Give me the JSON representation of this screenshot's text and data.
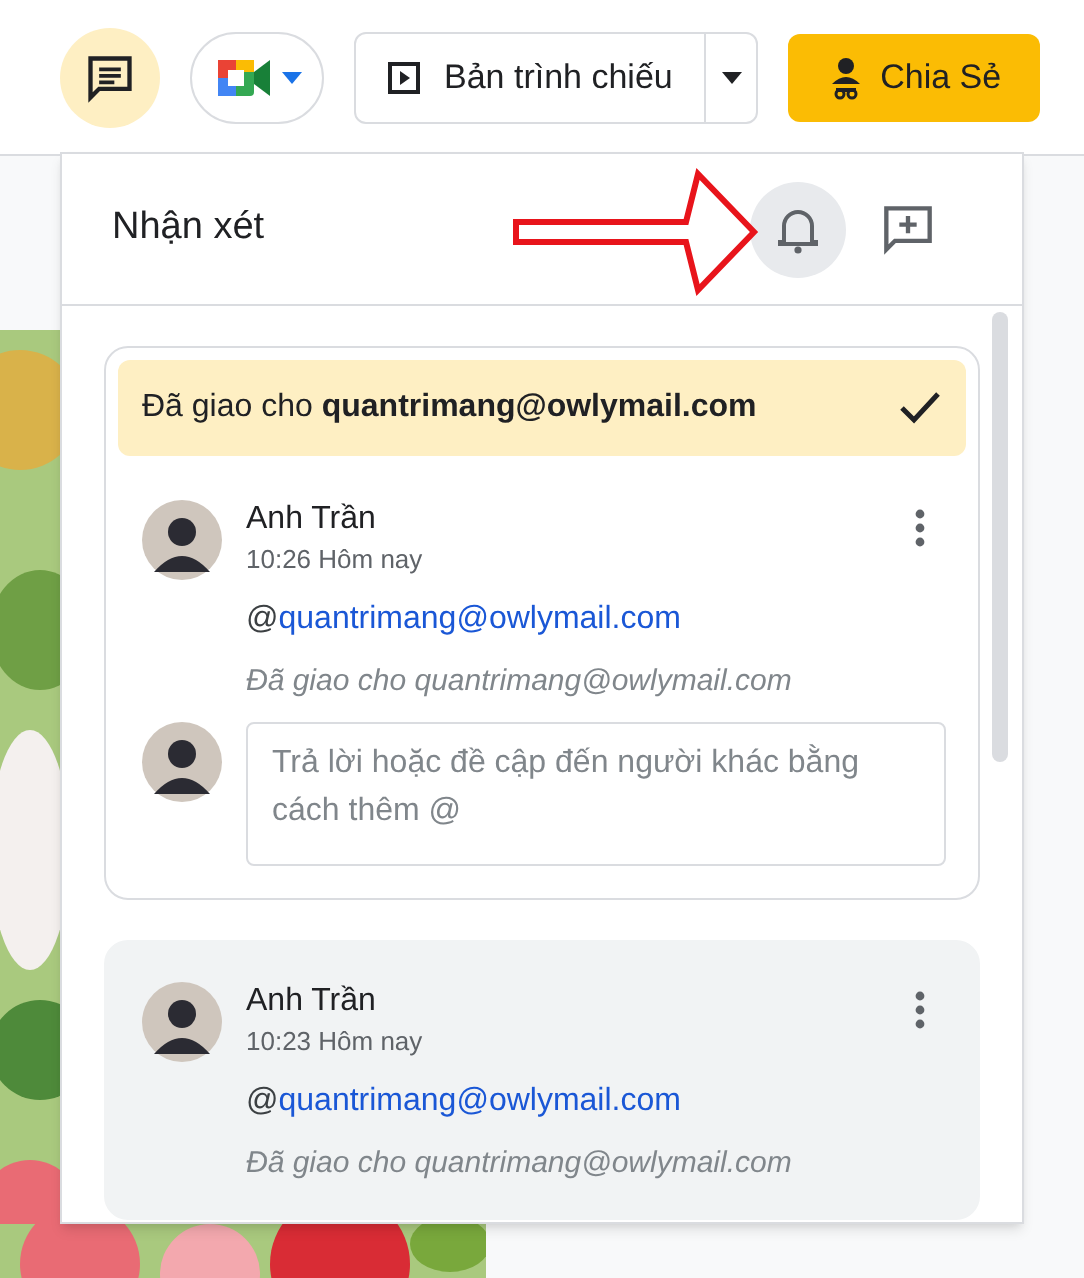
{
  "toolbar": {
    "comments_button": {
      "selected": true
    },
    "slideshow_button": {
      "label": "Bản trình chiếu"
    },
    "share_button": {
      "label": "Chia Sẻ"
    }
  },
  "comments_panel": {
    "title": "Nhận xét",
    "notifications_button": {
      "selected": true
    }
  },
  "threads": [
    {
      "selected": false,
      "banner": "Đã giao cho **quantrimang@owlymail.com**",
      "author": "Anh Trần",
      "time": "10:26 Hôm nay",
      "mention_prefix": "@",
      "mention": "quantrimang@owlymail.com",
      "assigned_note": "Đã giao cho quantrimang@owlymail.com",
      "reply": {
        "placeholder": "Trả lời hoặc đề cập đến người khác bằng cách thêm @"
      }
    },
    {
      "selected": true,
      "author": "Anh Trần",
      "time": "10:23 Hôm nay",
      "mention_prefix": "@",
      "mention": "quantrimang@owlymail.com",
      "assigned_note": "Đã giao cho quantrimang@owlymail.com"
    }
  ]
}
